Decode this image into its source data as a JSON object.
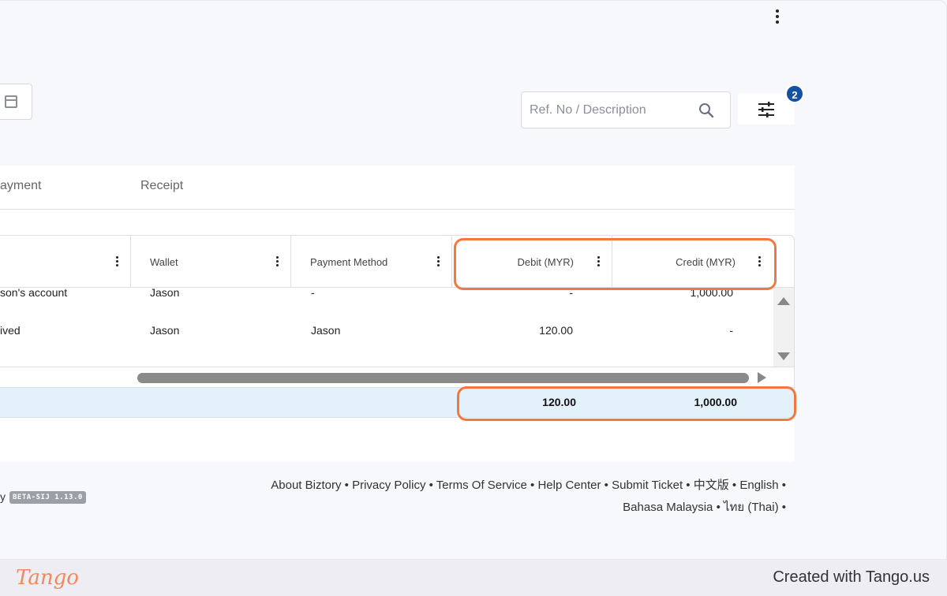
{
  "search": {
    "placeholder": "Ref. No / Description"
  },
  "filter": {
    "badge_count": "2"
  },
  "tabs": [
    {
      "label": "ayment"
    },
    {
      "label": "Receipt"
    }
  ],
  "table": {
    "columns": [
      {
        "label": ""
      },
      {
        "label": "Wallet"
      },
      {
        "label": "Payment Method"
      },
      {
        "label": "Debit (MYR)"
      },
      {
        "label": "Credit (MYR)"
      }
    ],
    "rows": [
      {
        "description": "son's account",
        "wallet": "Jason",
        "payment_method": "-",
        "debit": "-",
        "credit": "1,000.00"
      },
      {
        "description": "ived",
        "wallet": "Jason",
        "payment_method": "Jason",
        "debit": "120.00",
        "credit": "-"
      }
    ],
    "totals": {
      "debit": "120.00",
      "credit": "1,000.00"
    }
  },
  "footer": {
    "brand_fragment": "y",
    "version": "BETA-SIJ 1.13.0",
    "links": [
      "About Biztory",
      "Privacy Policy",
      "Terms Of Service",
      "Help Center",
      "Submit Ticket",
      "中文版",
      "English",
      "Bahasa Malaysia",
      "ไทย (Thai)"
    ],
    "separator": "•"
  },
  "tango": {
    "logo": "Tango",
    "created_with": "Created with Tango.us"
  },
  "colors": {
    "highlight": "#f5773d",
    "badge": "#1450a3",
    "total_row": "#e3f1fa"
  }
}
